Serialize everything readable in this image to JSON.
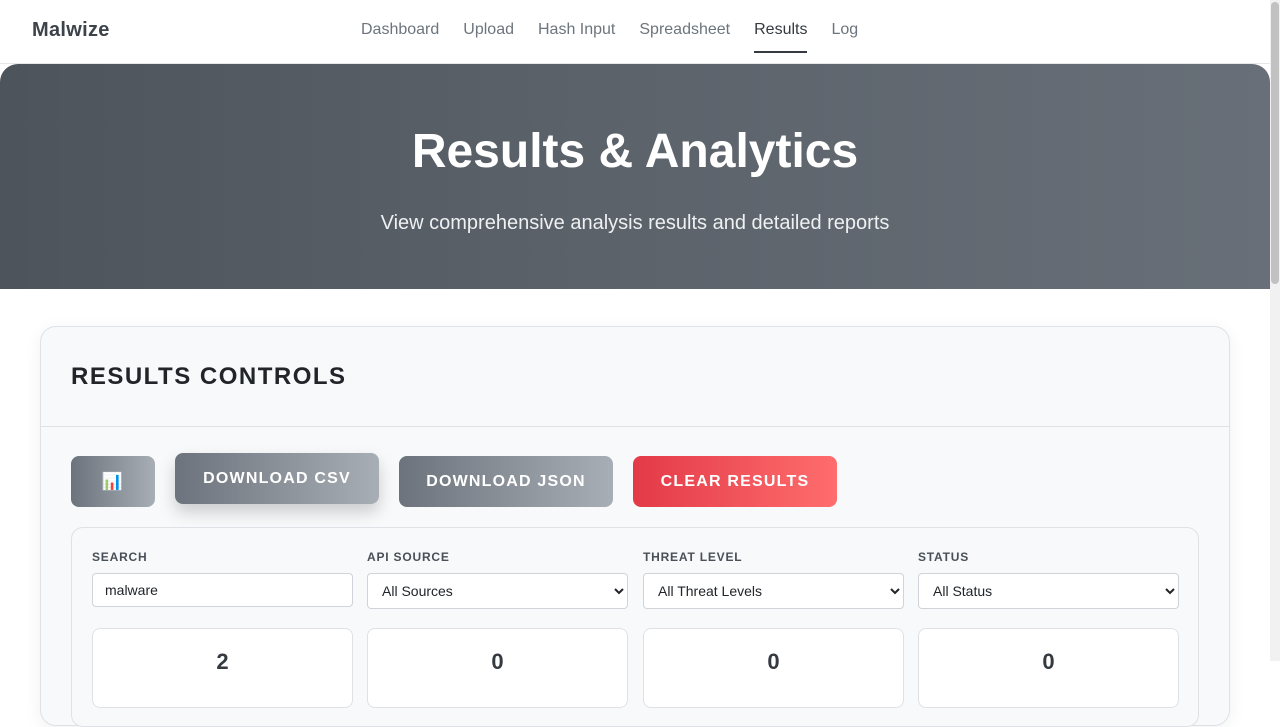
{
  "navbar": {
    "brand": "Malwize",
    "links": [
      {
        "label": "Dashboard"
      },
      {
        "label": "Upload"
      },
      {
        "label": "Hash Input"
      },
      {
        "label": "Spreadsheet"
      },
      {
        "label": "Results",
        "active": true
      },
      {
        "label": "Log"
      }
    ]
  },
  "hero": {
    "title": "Results & Analytics",
    "subtitle": "View comprehensive analysis results and detailed reports"
  },
  "controls": {
    "title": "RESULTS CONTROLS",
    "buttons": {
      "chart_icon": "📊",
      "download_csv": "DOWNLOAD CSV",
      "download_json": "DOWNLOAD JSON",
      "clear_results": "CLEAR RESULTS"
    },
    "filters": {
      "search": {
        "label": "SEARCH",
        "value": "malware"
      },
      "api_source": {
        "label": "API SOURCE",
        "selected": "All Sources"
      },
      "threat_level": {
        "label": "THREAT LEVEL",
        "selected": "All Threat Levels"
      },
      "status": {
        "label": "STATUS",
        "selected": "All Status"
      }
    },
    "stats": [
      "2",
      "0",
      "0",
      "0"
    ]
  },
  "colors": {
    "hero_gradient_start": "#4e545c",
    "hero_gradient_end": "#686f78",
    "button_gray_start": "#6c737c",
    "button_gray_end": "#a8aeb5",
    "button_red_start": "#e33a48",
    "button_red_end": "#ff6d6d"
  }
}
